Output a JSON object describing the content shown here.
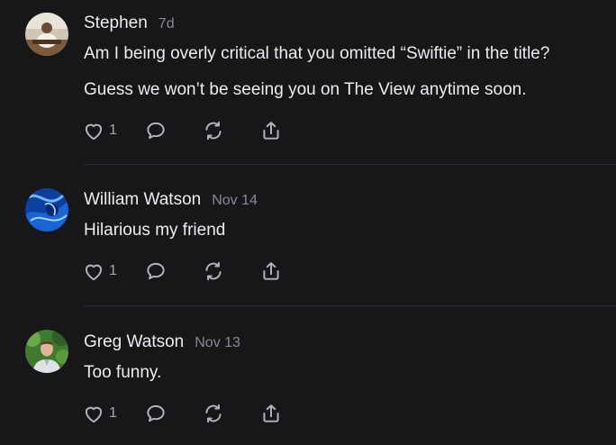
{
  "comments": [
    {
      "author": "Stephen",
      "date": "7d",
      "paragraphs": [
        "Am I being overly critical that you omitted “Swiftie” in the title?",
        "Guess we won’t be seeing you on The View anytime soon."
      ],
      "likes": "1",
      "avatar": "photo of person seated at table"
    },
    {
      "author": "William Watson",
      "date": "Nov 14",
      "paragraphs": [
        "Hilarious my friend"
      ],
      "likes": "1",
      "avatar": "blue abstract swirl image"
    },
    {
      "author": "Greg Watson",
      "date": "Nov 13",
      "paragraphs": [
        "Too funny."
      ],
      "likes": "1",
      "avatar": "photo of man in front of greenery"
    }
  ],
  "icons": {
    "like": "heart-icon",
    "reply": "speech-bubble-icon",
    "restack": "repost-icon",
    "share": "share-upload-icon"
  },
  "colors": {
    "background": "#17171a",
    "text": "#ededf0",
    "muted": "#8a8a90",
    "icon": "#b4b4b9",
    "divider": "#2c2c30"
  }
}
